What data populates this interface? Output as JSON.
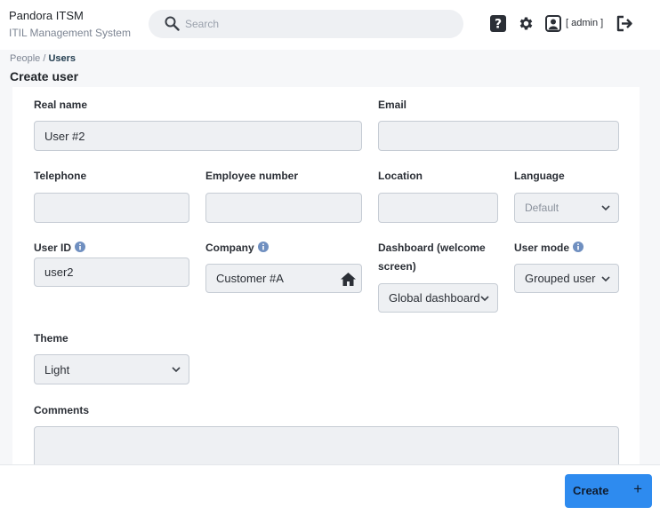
{
  "app": {
    "title": "Pandora ITSM",
    "subtitle": "ITIL Management System"
  },
  "header": {
    "search_placeholder": "Search",
    "user_label": "[ admin ]",
    "icons": [
      "help-icon",
      "gear-icon",
      "user-icon",
      "logout-icon"
    ]
  },
  "breadcrumb": {
    "parent": "People",
    "separator": " / ",
    "current": "Users"
  },
  "page": {
    "title": "Create user"
  },
  "form": {
    "real_name": {
      "label": "Real name",
      "value": "User #2"
    },
    "email": {
      "label": "Email",
      "value": ""
    },
    "telephone": {
      "label": "Telephone",
      "value": ""
    },
    "employee_number": {
      "label": "Employee number",
      "value": ""
    },
    "location": {
      "label": "Location",
      "value": ""
    },
    "language": {
      "label": "Language",
      "value": "Default"
    },
    "user_id": {
      "label": "User ID",
      "value": "user2"
    },
    "company": {
      "label": "Company",
      "value": "Customer #A"
    },
    "dashboard": {
      "label_line1": "Dashboard (welcome",
      "label_line2": "screen)",
      "value": "Global dashboard"
    },
    "user_mode": {
      "label": "User mode",
      "value": "Grouped user"
    },
    "theme": {
      "label": "Theme",
      "value": "Light"
    },
    "comments": {
      "label": "Comments",
      "value": ""
    }
  },
  "footer": {
    "create_label": "Create",
    "create_icon": "+"
  },
  "colors": {
    "accent": "#2e8bef",
    "info": "#6f8fc0",
    "field_bg": "#eef0f3"
  }
}
